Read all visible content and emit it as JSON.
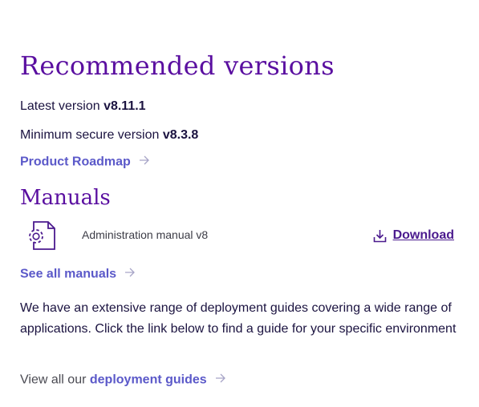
{
  "recommended": {
    "heading": "Recommended versions",
    "latest_label": "Latest version",
    "latest_value": "v8.11.1",
    "minimum_label": "Minimum secure version",
    "minimum_value": "v8.3.8",
    "roadmap_link": "Product Roadmap"
  },
  "manuals": {
    "heading": "Manuals",
    "items": [
      {
        "title": "Administration manual v8",
        "icon": "document-gear-icon",
        "action_label": "Download",
        "action_icon": "download-icon"
      }
    ],
    "see_all_link": "See all manuals"
  },
  "deployment": {
    "paragraph": "We have an extensive range of deployment guides covering a wide range of applications. Click the link below to find a guide for your specific environment",
    "prefix": "View all our",
    "link": "deployment guides"
  },
  "colors": {
    "heading": "#5a0fa0",
    "link": "#5b59c9",
    "download": "#4b1a8e",
    "text": "#1b1340"
  }
}
